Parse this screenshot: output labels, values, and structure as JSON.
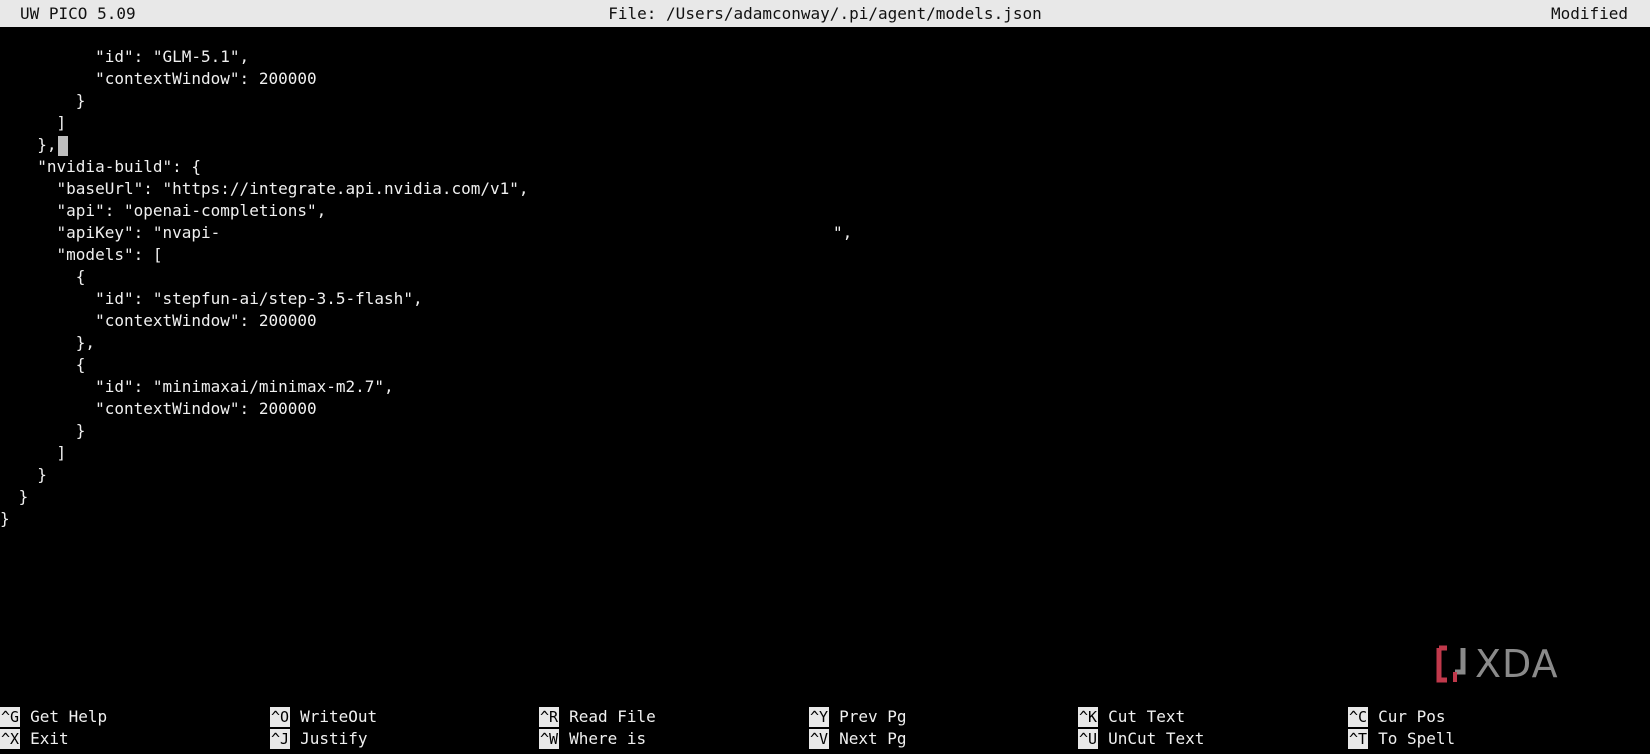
{
  "titlebar": {
    "app": "UW PICO 5.09",
    "file": "File: /Users/adamconway/.pi/agent/models.json",
    "status": "Modified"
  },
  "editor": {
    "lines": [
      "        \"id\": \"GLM-5.1\",",
      "        \"contextWindow\": 200000",
      "      }",
      "    ]",
      "  },",
      "  \"nvidia-build\": {",
      "    \"baseUrl\": \"https://integrate.api.nvidia.com/v1\",",
      "    \"api\": \"openai-completions\",",
      "    \"apiKey\": \"nvapi-",
      "    \"models\": [",
      "      {",
      "        \"id\": \"stepfun-ai/step-3.5-flash\",",
      "        \"contextWindow\": 200000",
      "      },",
      "      {",
      "        \"id\": \"minimaxai/minimax-m2.7\",",
      "        \"contextWindow\": 200000",
      "      }",
      "    ]",
      "  }",
      " }",
      "}"
    ],
    "apikey_tail": "\","
  },
  "watermark": {
    "text": "XDA"
  },
  "shortcuts": [
    {
      "key": "^G",
      "label": "Get Help"
    },
    {
      "key": "^X",
      "label": "Exit"
    },
    {
      "key": "^O",
      "label": "WriteOut"
    },
    {
      "key": "^J",
      "label": "Justify"
    },
    {
      "key": "^R",
      "label": "Read File"
    },
    {
      "key": "^W",
      "label": "Where is"
    },
    {
      "key": "^Y",
      "label": "Prev Pg"
    },
    {
      "key": "^V",
      "label": "Next Pg"
    },
    {
      "key": "^K",
      "label": "Cut Text"
    },
    {
      "key": "^U",
      "label": "UnCut Text"
    },
    {
      "key": "^C",
      "label": "Cur Pos"
    },
    {
      "key": "^T",
      "label": "To Spell"
    }
  ],
  "colors": {
    "background": "#000000",
    "titlebar": "#e8e8e8",
    "text": "#f0f0f0",
    "watermark_bracket": "#c0394b"
  }
}
